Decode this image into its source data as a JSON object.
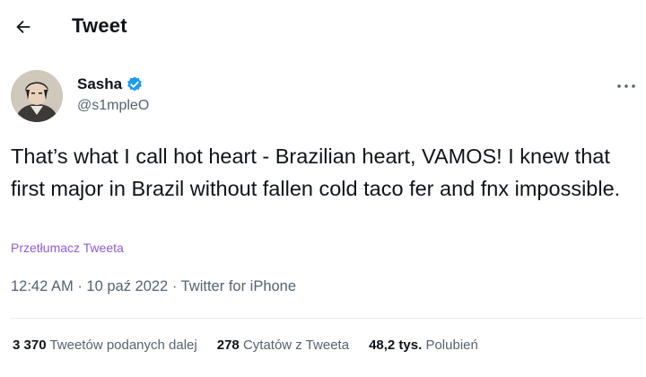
{
  "header": {
    "title": "Tweet",
    "back_icon": "arrow-left-icon"
  },
  "author": {
    "name": "Sasha",
    "handle": "@s1mpleO",
    "verified_icon": "verified-badge-icon",
    "verified_color": "#1d9bf0",
    "more_icon": "more-horizontal-icon"
  },
  "tweet": {
    "text": "That’s what I call hot heart - Brazilian heart, VAMOS! I knew that first major in Brazil without fallen cold taco fer and fnx impossible.",
    "translate_label": "Przetłumacz Tweeta"
  },
  "meta": {
    "time": "12:42 AM",
    "date": "10 paź 2022",
    "separator": "·",
    "source": "Twitter for iPhone"
  },
  "stats": [
    {
      "value": "3 370",
      "label": "Tweetów podanych dalej"
    },
    {
      "value": "278",
      "label": "Cytatów z Tweeta"
    },
    {
      "value": "48,2 tys.",
      "label": "Polubień"
    }
  ],
  "colors": {
    "text": "#0f1419",
    "secondary": "#536471",
    "accent": "#1d9bf0",
    "translate": "#8c5dd9",
    "divider": "#e6ecf0"
  }
}
